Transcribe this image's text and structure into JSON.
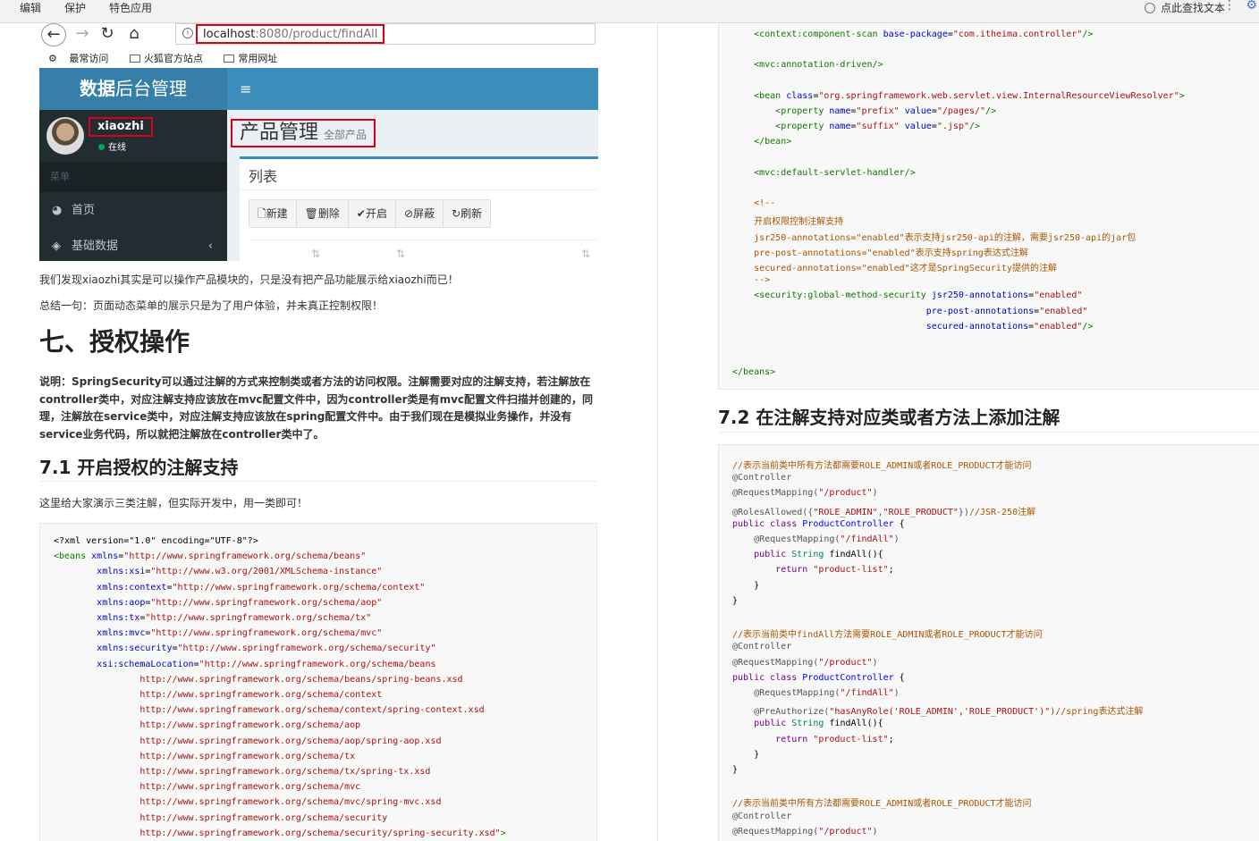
{
  "topbar": {
    "menu": [
      "编辑",
      "保护",
      "特色应用"
    ],
    "find_label": "点此查找文本",
    "more": "⋮"
  },
  "browser": {
    "url_host": "localhost",
    "url_path": ":8080/product/findAll",
    "bookmarks": [
      "最常访问",
      "火狐官方站点",
      "常用网址"
    ],
    "brand_bold": "数据",
    "brand_rest": "后台管理",
    "username": "xiaozhi",
    "status": "在线",
    "menu_header": "菜单",
    "side_items": [
      {
        "icon": "dashboard-icon",
        "label": "首页"
      },
      {
        "icon": "cube-icon",
        "label": "基础数据"
      }
    ],
    "page_title": "产品管理",
    "page_subtitle": "全部产品",
    "box_title": "列表",
    "buttons": [
      {
        "icon": "file-icon",
        "label": "新建"
      },
      {
        "icon": "trash-icon",
        "label": "删除"
      },
      {
        "icon": "check-icon",
        "label": "开启"
      },
      {
        "icon": "ban-icon",
        "label": "屏蔽"
      },
      {
        "icon": "refresh-icon",
        "label": "刷新"
      }
    ]
  },
  "doc": {
    "para1": "我们发现xiaozhi其实是可以操作产品模块的，只是没有把产品功能展示给xiaozhi而已！",
    "para2": "总结一句：页面动态菜单的展示只是为了用户体验，并未真正控制权限！",
    "h1": "七、授权操作",
    "note": "说明：SpringSecurity可以通过注解的方式来控制类或者方法的访问权限。注解需要对应的注解支持，若注解放在controller类中，对应注解支持应该放在mvc配置文件中，因为controller类是有mvc配置文件扫描并创建的，同理，注解放在service类中，对应注解支持应该放在spring配置文件中。由于我们现在是模拟业务操作，并没有service业务代码，所以就把注解放在controller类中了。",
    "h2_71": "7.1 开启授权的注解支持",
    "para3": "这里给大家演示三类注解，但实际开发中，用一类即可！",
    "h2_72": "7.2 在注解支持对应类或者方法上添加注解"
  },
  "code_left": [
    [
      [
        "pl",
        "<?xml version=\"1.0\" encoding=\"UTF-8\"?>"
      ]
    ],
    [
      [
        "tag",
        "<beans "
      ],
      [
        "attr",
        "xmlns"
      ],
      [
        "pl",
        "="
      ],
      [
        "str",
        "\"http://www.springframework.org/schema/beans\""
      ]
    ],
    [
      [
        "pl",
        "        "
      ],
      [
        "attr",
        "xmlns:xsi"
      ],
      [
        "pl",
        "="
      ],
      [
        "str",
        "\"http://www.w3.org/2001/XMLSchema-instance\""
      ]
    ],
    [
      [
        "pl",
        "        "
      ],
      [
        "attr",
        "xmlns:context"
      ],
      [
        "pl",
        "="
      ],
      [
        "str",
        "\"http://www.springframework.org/schema/context\""
      ]
    ],
    [
      [
        "pl",
        "        "
      ],
      [
        "attr",
        "xmlns:aop"
      ],
      [
        "pl",
        "="
      ],
      [
        "str",
        "\"http://www.springframework.org/schema/aop\""
      ]
    ],
    [
      [
        "pl",
        "        "
      ],
      [
        "attr",
        "xmlns:tx"
      ],
      [
        "pl",
        "="
      ],
      [
        "str",
        "\"http://www.springframework.org/schema/tx\""
      ]
    ],
    [
      [
        "pl",
        "        "
      ],
      [
        "attr",
        "xmlns:mvc"
      ],
      [
        "pl",
        "="
      ],
      [
        "str",
        "\"http://www.springframework.org/schema/mvc\""
      ]
    ],
    [
      [
        "pl",
        "        "
      ],
      [
        "attr",
        "xmlns:security"
      ],
      [
        "pl",
        "="
      ],
      [
        "str",
        "\"http://www.springframework.org/schema/security\""
      ]
    ],
    [
      [
        "pl",
        "        "
      ],
      [
        "attr",
        "xsi:schemaLocation"
      ],
      [
        "pl",
        "="
      ],
      [
        "str",
        "\"http://www.springframework.org/schema/beans"
      ]
    ],
    [
      [
        "str",
        "                http://www.springframework.org/schema/beans/spring-beans.xsd"
      ]
    ],
    [
      [
        "str",
        "                http://www.springframework.org/schema/context"
      ]
    ],
    [
      [
        "str",
        "                http://www.springframework.org/schema/context/spring-context.xsd"
      ]
    ],
    [
      [
        "str",
        "                http://www.springframework.org/schema/aop"
      ]
    ],
    [
      [
        "str",
        "                http://www.springframework.org/schema/aop/spring-aop.xsd"
      ]
    ],
    [
      [
        "str",
        "                http://www.springframework.org/schema/tx"
      ]
    ],
    [
      [
        "str",
        "                http://www.springframework.org/schema/tx/spring-tx.xsd"
      ]
    ],
    [
      [
        "str",
        "                http://www.springframework.org/schema/mvc"
      ]
    ],
    [
      [
        "str",
        "                http://www.springframework.org/schema/mvc/spring-mvc.xsd"
      ]
    ],
    [
      [
        "str",
        "                http://www.springframework.org/schema/security"
      ]
    ],
    [
      [
        "str",
        "                http://www.springframework.org/schema/security/spring-security.xsd\""
      ],
      [
        "tag",
        ">"
      ]
    ]
  ],
  "code_right_top": [
    [
      [
        "pl",
        "    "
      ],
      [
        "tag",
        "<context:component-scan "
      ],
      [
        "attr",
        "base-package"
      ],
      [
        "pl",
        "="
      ],
      [
        "str",
        "\"com.itheima.controller\""
      ],
      [
        "tag",
        "/>"
      ]
    ],
    [
      [
        "pl",
        ""
      ]
    ],
    [
      [
        "pl",
        "    "
      ],
      [
        "tag",
        "<mvc:annotation-driven/>"
      ]
    ],
    [
      [
        "pl",
        ""
      ]
    ],
    [
      [
        "pl",
        "    "
      ],
      [
        "tag",
        "<bean "
      ],
      [
        "attr",
        "class"
      ],
      [
        "pl",
        "="
      ],
      [
        "str",
        "\"org.springframework.web.servlet.view.InternalResourceViewResolver\""
      ],
      [
        "tag",
        ">"
      ]
    ],
    [
      [
        "pl",
        "        "
      ],
      [
        "tag",
        "<property "
      ],
      [
        "attr",
        "name"
      ],
      [
        "pl",
        "="
      ],
      [
        "str",
        "\"prefix\""
      ],
      [
        "pl",
        " "
      ],
      [
        "attr",
        "value"
      ],
      [
        "pl",
        "="
      ],
      [
        "str",
        "\"/pages/\""
      ],
      [
        "tag",
        "/>"
      ]
    ],
    [
      [
        "pl",
        "        "
      ],
      [
        "tag",
        "<property "
      ],
      [
        "attr",
        "name"
      ],
      [
        "pl",
        "="
      ],
      [
        "str",
        "\"suffix\""
      ],
      [
        "pl",
        " "
      ],
      [
        "attr",
        "value"
      ],
      [
        "pl",
        "="
      ],
      [
        "str",
        "\".jsp\""
      ],
      [
        "tag",
        "/>"
      ]
    ],
    [
      [
        "pl",
        "    "
      ],
      [
        "tag",
        "</bean>"
      ]
    ],
    [
      [
        "pl",
        ""
      ]
    ],
    [
      [
        "pl",
        "    "
      ],
      [
        "tag",
        "<mvc:default-servlet-handler/>"
      ]
    ],
    [
      [
        "pl",
        ""
      ]
    ],
    [
      [
        "pl",
        "    "
      ],
      [
        "com",
        "<!--"
      ]
    ],
    [
      [
        "pl",
        "    "
      ],
      [
        "com",
        "开启权限控制注解支持"
      ]
    ],
    [
      [
        "pl",
        "    "
      ],
      [
        "com",
        "jsr250-annotations=\"enabled\"表示支持jsr250-api的注解，需要jsr250-api的jar包"
      ]
    ],
    [
      [
        "pl",
        "    "
      ],
      [
        "com",
        "pre-post-annotations=\"enabled\"表示支持spring表达式注解"
      ]
    ],
    [
      [
        "pl",
        "    "
      ],
      [
        "com",
        "secured-annotations=\"enabled\"这才是SpringSecurity提供的注解"
      ]
    ],
    [
      [
        "pl",
        "    "
      ],
      [
        "com",
        "-->"
      ]
    ],
    [
      [
        "pl",
        "    "
      ],
      [
        "tag",
        "<security:global-method-security "
      ],
      [
        "attr",
        "jsr250-annotations"
      ],
      [
        "pl",
        "="
      ],
      [
        "str",
        "\"enabled\""
      ]
    ],
    [
      [
        "pl",
        "                                    "
      ],
      [
        "attr",
        "pre-post-annotations"
      ],
      [
        "pl",
        "="
      ],
      [
        "str",
        "\"enabled\""
      ]
    ],
    [
      [
        "pl",
        "                                    "
      ],
      [
        "attr",
        "secured-annotations"
      ],
      [
        "pl",
        "="
      ],
      [
        "str",
        "\"enabled\""
      ],
      [
        "tag",
        "/>"
      ]
    ],
    [
      [
        "pl",
        ""
      ]
    ],
    [
      [
        "pl",
        ""
      ]
    ],
    [
      [
        "tag",
        "</beans>"
      ]
    ]
  ],
  "code_right_bottom": [
    [
      [
        "com",
        "//表示当前类中所有方法都需要ROLE_ADMIN或者ROLE_PRODUCT才能访问"
      ]
    ],
    [
      [
        "ann",
        "@Controller"
      ]
    ],
    [
      [
        "ann",
        "@RequestMapping("
      ],
      [
        "str",
        "\"/product\""
      ],
      [
        "ann",
        ")"
      ]
    ],
    [
      [
        "ann",
        "@RolesAllowed({"
      ],
      [
        "str",
        "\"ROLE_ADMIN\""
      ],
      [
        "ann",
        ","
      ],
      [
        "str",
        "\"ROLE_PRODUCT\""
      ],
      [
        "ann",
        "})"
      ],
      [
        "com",
        "//JSR-250注解"
      ]
    ],
    [
      [
        "kw",
        "public class "
      ],
      [
        "def",
        "ProductController"
      ],
      [
        "pl",
        " {"
      ]
    ],
    [
      [
        "pl",
        "    "
      ],
      [
        "ann",
        "@RequestMapping("
      ],
      [
        "str",
        "\"/findAll\""
      ],
      [
        "ann",
        ")"
      ]
    ],
    [
      [
        "pl",
        "    "
      ],
      [
        "kw",
        "public "
      ],
      [
        "typ",
        "String "
      ],
      [
        "pl",
        "findAll(){"
      ]
    ],
    [
      [
        "pl",
        "        "
      ],
      [
        "kw",
        "return "
      ],
      [
        "str",
        "\"product-list\""
      ],
      [
        "pl",
        ";"
      ]
    ],
    [
      [
        "pl",
        "    }"
      ]
    ],
    [
      [
        "pl",
        "}"
      ]
    ],
    [
      [
        "pl",
        ""
      ]
    ],
    [
      [
        "com",
        "//表示当前类中findAll方法需要ROLE_ADMIN或者ROLE_PRODUCT才能访问"
      ]
    ],
    [
      [
        "ann",
        "@Controller"
      ]
    ],
    [
      [
        "ann",
        "@RequestMapping("
      ],
      [
        "str",
        "\"/product\""
      ],
      [
        "ann",
        ")"
      ]
    ],
    [
      [
        "kw",
        "public class "
      ],
      [
        "def",
        "ProductController"
      ],
      [
        "pl",
        " {"
      ]
    ],
    [
      [
        "pl",
        "    "
      ],
      [
        "ann",
        "@RequestMapping("
      ],
      [
        "str",
        "\"/findAll\""
      ],
      [
        "ann",
        ")"
      ]
    ],
    [
      [
        "pl",
        "    "
      ],
      [
        "ann",
        "@PreAuthorize("
      ],
      [
        "str",
        "\"hasAnyRole('ROLE_ADMIN','ROLE_PRODUCT')\""
      ],
      [
        "ann",
        ")"
      ],
      [
        "com",
        "//spring表达式注解"
      ]
    ],
    [
      [
        "pl",
        "    "
      ],
      [
        "kw",
        "public "
      ],
      [
        "typ",
        "String "
      ],
      [
        "pl",
        "findAll(){"
      ]
    ],
    [
      [
        "pl",
        "        "
      ],
      [
        "kw",
        "return "
      ],
      [
        "str",
        "\"product-list\""
      ],
      [
        "pl",
        ";"
      ]
    ],
    [
      [
        "pl",
        "    }"
      ]
    ],
    [
      [
        "pl",
        "}"
      ]
    ],
    [
      [
        "pl",
        ""
      ]
    ],
    [
      [
        "com",
        "//表示当前类中所有方法都需要ROLE_ADMIN或者ROLE_PRODUCT才能访问"
      ]
    ],
    [
      [
        "ann",
        "@Controller"
      ]
    ],
    [
      [
        "ann",
        "@RequestMapping("
      ],
      [
        "str",
        "\"/product\""
      ],
      [
        "ann",
        ")"
      ]
    ]
  ]
}
